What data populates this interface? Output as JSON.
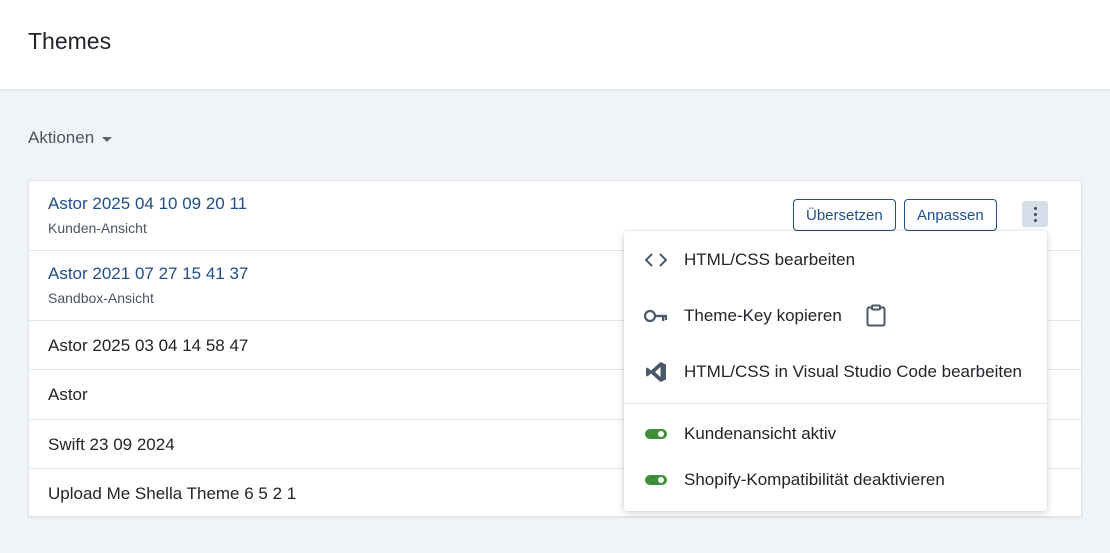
{
  "header": {
    "title": "Themes"
  },
  "actions": {
    "label": "Aktionen"
  },
  "themes": [
    {
      "name": "Astor 2025 04 10 09 20 11",
      "subtitle": "Kunden-Ansicht"
    },
    {
      "name": "Astor 2021 07 27 15 41 37",
      "subtitle": "Sandbox-Ansicht"
    },
    {
      "name": "Astor 2025 03 04 14 58 47"
    },
    {
      "name": "Astor"
    },
    {
      "name": "Swift 23 09 2024"
    },
    {
      "name": "Upload Me Shella Theme 6 5 2 1"
    }
  ],
  "row_buttons": {
    "translate": "Übersetzen",
    "customize": "Anpassen"
  },
  "menu": {
    "items": [
      {
        "label": "HTML/CSS bearbeiten",
        "icon": "code-icon"
      },
      {
        "label": "Theme-Key kopieren",
        "icon": "key-icon"
      },
      {
        "label": "HTML/CSS in Visual Studio Code bearbeiten",
        "icon": "vscode-icon"
      },
      {
        "label": "Kundenansicht aktiv",
        "icon": "toggle-on-icon"
      },
      {
        "label": "Shopify-Kompatibilität deaktivieren",
        "icon": "toggle-on-icon"
      }
    ]
  },
  "colors": {
    "link": "#1f4f8a",
    "toggle": "#3f8f3a",
    "icon": "#4a5a6a",
    "background": "#f1f4f7"
  }
}
